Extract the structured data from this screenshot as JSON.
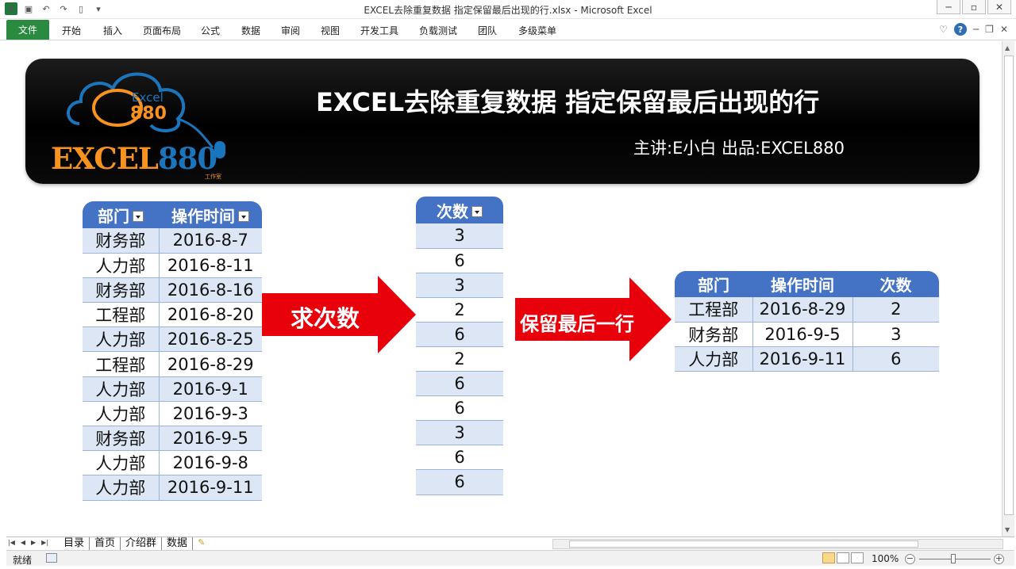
{
  "window": {
    "title": "EXCEL去除重复数据 指定保留最后出现的行.xlsx - Microsoft Excel",
    "app_icon": "excel-icon",
    "controls": [
      "─",
      "▫",
      "✕"
    ]
  },
  "quick_access": {
    "items": [
      "save-icon",
      "undo-icon",
      "redo-icon",
      "new-icon",
      "customize-icon"
    ]
  },
  "ribbon": {
    "file_tab": "文件",
    "tabs": [
      "开始",
      "插入",
      "页面布局",
      "公式",
      "数据",
      "审阅",
      "视图",
      "开发工具",
      "负载测试",
      "团队",
      "多级菜单"
    ],
    "right_icons": [
      "collapse-ribbon-icon",
      "help-icon",
      "minimize-icon",
      "restore-icon",
      "close-icon"
    ]
  },
  "banner": {
    "title": "EXCEL去除重复数据 指定保留最后出现的行",
    "subtitle": "主讲:E小白   出品:EXCEL880",
    "logo": {
      "cloud_text": "Excel",
      "cloud_number": "880",
      "wordmark_a": "EXCEL",
      "wordmark_b": "880",
      "tag": "工作室",
      "colors": {
        "orange": "#f7931e",
        "blue": "#1b75bc"
      }
    }
  },
  "source_table": {
    "headers": [
      "部门",
      "操作时间"
    ],
    "rows": [
      [
        "财务部",
        "2016-8-7"
      ],
      [
        "人力部",
        "2016-8-11"
      ],
      [
        "财务部",
        "2016-8-16"
      ],
      [
        "工程部",
        "2016-8-20"
      ],
      [
        "人力部",
        "2016-8-25"
      ],
      [
        "工程部",
        "2016-8-29"
      ],
      [
        "人力部",
        "2016-9-1"
      ],
      [
        "人力部",
        "2016-9-3"
      ],
      [
        "财务部",
        "2016-9-5"
      ],
      [
        "人力部",
        "2016-9-8"
      ],
      [
        "人力部",
        "2016-9-11"
      ]
    ]
  },
  "count_table": {
    "header": "次数",
    "values": [
      "3",
      "6",
      "3",
      "2",
      "6",
      "2",
      "6",
      "6",
      "3",
      "6",
      "6"
    ]
  },
  "arrows": [
    {
      "label": "求次数",
      "color": "#e8000b"
    },
    {
      "label": "保留最后一行",
      "color": "#e8000b"
    }
  ],
  "result_table": {
    "headers": [
      "部门",
      "操作时间",
      "次数"
    ],
    "rows": [
      [
        "工程部",
        "2016-8-29",
        "2"
      ],
      [
        "财务部",
        "2016-9-5",
        "3"
      ],
      [
        "人力部",
        "2016-9-11",
        "6"
      ]
    ]
  },
  "sheet_tabs": [
    "目录",
    "首页",
    "介绍群",
    "数据"
  ],
  "status": {
    "ready": "就绪",
    "zoom": "100%"
  },
  "colors": {
    "table_header": "#4472c4",
    "band": "#dce6f4",
    "file_tab": "#2a8a3f"
  }
}
